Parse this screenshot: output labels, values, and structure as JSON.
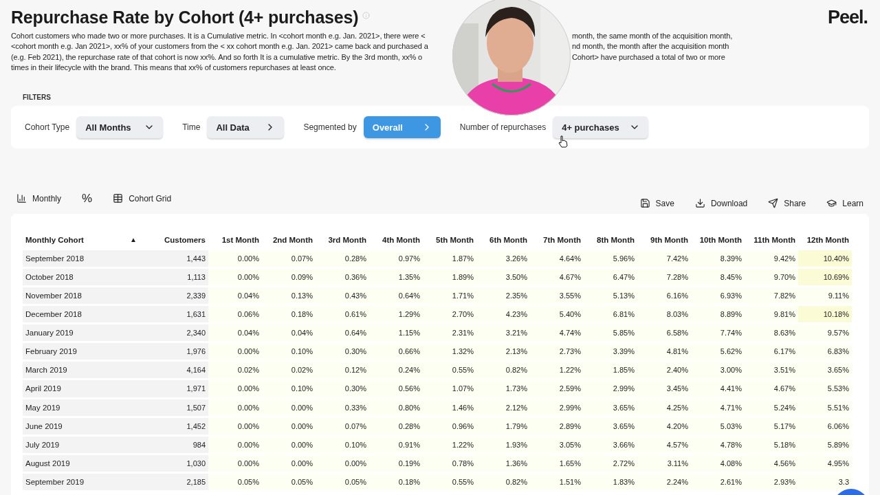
{
  "header": {
    "title": "Repurchase Rate by Cohort (4+ purchases)",
    "logo": "Peel.",
    "description_lines": [
      {
        "left": "Cohort customers who made two or more purchases. It is a Cumulative metric. In <cohort month e.g. Jan. 2021>, there were <",
        "right": "month, the same month of the acquisition month,"
      },
      {
        "left": "<cohort month e.g. Jan 2021>, xx% of your customers from the < xx cohort month e.g. Jan. 2021> came back and purchased a",
        "right": "nd month, the month after the acquisition month"
      },
      {
        "left": "(e.g. Feb 2021), the repurchase rate of that cohort is now xx%. And so forth It is a cumulative metric. By the 3rd month, xx% o",
        "right": "Cohort> have purchased a total of two or more"
      },
      {
        "left": "times in their lifecycle with the brand. This means that xx% of customers repurchases at least once."
      }
    ]
  },
  "filters": {
    "heading": "FILTERS",
    "items": [
      {
        "label": "Cohort Type",
        "value": "All Months",
        "kind": "dropdown",
        "highlighted": false
      },
      {
        "label": "Time",
        "value": "All Data",
        "kind": "link",
        "highlighted": false
      },
      {
        "label": "Segmented by",
        "value": "Overall",
        "kind": "link",
        "highlighted": true
      },
      {
        "label": "Number of repurchases",
        "value": "4+ purchases",
        "kind": "dropdown",
        "highlighted": false
      }
    ]
  },
  "view_toolbar": {
    "left": [
      {
        "kind": "chart",
        "label": "Monthly"
      },
      {
        "kind": "text",
        "label": "%"
      },
      {
        "kind": "grid",
        "label": "Cohort Grid"
      }
    ],
    "right": [
      {
        "kind": "save",
        "label": "Save"
      },
      {
        "kind": "download",
        "label": "Download"
      },
      {
        "kind": "share",
        "label": "Share"
      },
      {
        "kind": "learn",
        "label": "Learn"
      }
    ]
  },
  "table": {
    "sort_indicator": "▲",
    "columns": [
      "Monthly Cohort",
      "Customers",
      "1st Month",
      "2nd Month",
      "3rd Month",
      "4th Month",
      "5th Month",
      "6th Month",
      "7th Month",
      "8th Month",
      "9th Month",
      "10th Month",
      "11th Month",
      "12th Month"
    ],
    "rows": [
      [
        "September 2018",
        "1,443",
        "0.00%",
        "0.07%",
        "0.28%",
        "0.97%",
        "1.87%",
        "3.26%",
        "4.64%",
        "5.96%",
        "7.42%",
        "8.39%",
        "9.42%",
        "10.40%"
      ],
      [
        "October 2018",
        "1,113",
        "0.00%",
        "0.09%",
        "0.36%",
        "1.35%",
        "1.89%",
        "3.50%",
        "4.67%",
        "6.47%",
        "7.28%",
        "8.45%",
        "9.70%",
        "10.69%"
      ],
      [
        "November 2018",
        "2,339",
        "0.04%",
        "0.13%",
        "0.43%",
        "0.64%",
        "1.71%",
        "2.35%",
        "3.55%",
        "5.13%",
        "6.16%",
        "6.93%",
        "7.82%",
        "9.11%"
      ],
      [
        "December 2018",
        "1,631",
        "0.06%",
        "0.18%",
        "0.61%",
        "1.29%",
        "2.70%",
        "4.23%",
        "5.40%",
        "6.81%",
        "8.03%",
        "8.89%",
        "9.81%",
        "10.18%"
      ],
      [
        "January 2019",
        "2,340",
        "0.04%",
        "0.04%",
        "0.64%",
        "1.15%",
        "2.31%",
        "3.21%",
        "4.74%",
        "5.85%",
        "6.58%",
        "7.74%",
        "8.63%",
        "9.57%"
      ],
      [
        "February 2019",
        "1,976",
        "0.00%",
        "0.10%",
        "0.30%",
        "0.66%",
        "1.32%",
        "2.13%",
        "2.73%",
        "3.39%",
        "4.81%",
        "5.62%",
        "6.17%",
        "6.83%"
      ],
      [
        "March 2019",
        "4,164",
        "0.02%",
        "0.02%",
        "0.12%",
        "0.24%",
        "0.55%",
        "0.82%",
        "1.22%",
        "1.85%",
        "2.40%",
        "3.00%",
        "3.51%",
        "3.65%"
      ],
      [
        "April 2019",
        "1,971",
        "0.00%",
        "0.10%",
        "0.30%",
        "0.56%",
        "1.07%",
        "1.73%",
        "2.59%",
        "2.99%",
        "3.45%",
        "4.41%",
        "4.67%",
        "5.53%"
      ],
      [
        "May 2019",
        "1,507",
        "0.00%",
        "0.00%",
        "0.33%",
        "0.80%",
        "1.46%",
        "2.12%",
        "2.99%",
        "3.65%",
        "4.25%",
        "4.71%",
        "5.24%",
        "5.51%"
      ],
      [
        "June 2019",
        "1,452",
        "0.00%",
        "0.00%",
        "0.07%",
        "0.28%",
        "0.96%",
        "1.79%",
        "2.89%",
        "3.65%",
        "4.20%",
        "5.03%",
        "5.17%",
        "6.06%"
      ],
      [
        "July 2019",
        "984",
        "0.00%",
        "0.00%",
        "0.10%",
        "0.91%",
        "1.22%",
        "1.93%",
        "3.05%",
        "3.66%",
        "4.57%",
        "4.78%",
        "5.18%",
        "5.89%"
      ],
      [
        "August 2019",
        "1,030",
        "0.00%",
        "0.00%",
        "0.00%",
        "0.19%",
        "0.78%",
        "1.36%",
        "1.65%",
        "2.72%",
        "3.11%",
        "4.08%",
        "4.56%",
        "4.95%"
      ],
      [
        "September 2019",
        "2,185",
        "0.05%",
        "0.05%",
        "0.05%",
        "0.18%",
        "0.55%",
        "0.82%",
        "1.51%",
        "1.83%",
        "2.24%",
        "2.61%",
        "2.93%",
        "3.3"
      ]
    ]
  }
}
